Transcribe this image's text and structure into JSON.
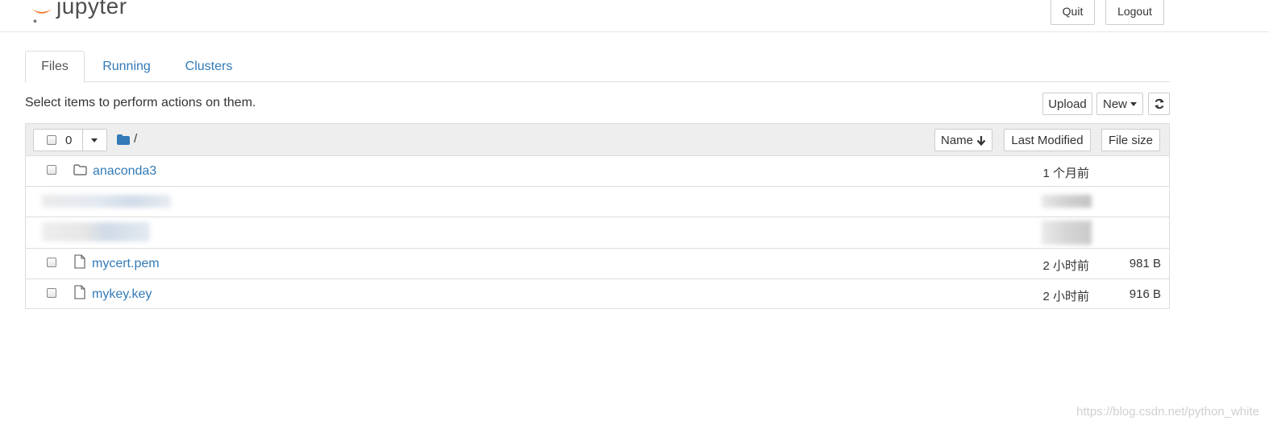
{
  "header": {
    "logo_text": "jupyter",
    "quit_label": "Quit",
    "logout_label": "Logout"
  },
  "tabs": [
    {
      "label": "Files",
      "active": true
    },
    {
      "label": "Running",
      "active": false
    },
    {
      "label": "Clusters",
      "active": false
    }
  ],
  "toolbar": {
    "message": "Select items to perform actions on them.",
    "upload_label": "Upload",
    "new_label": "New",
    "refresh_icon": "refresh-icon"
  },
  "list_header": {
    "selected_count": "0",
    "path": "/",
    "sort_name_label": "Name",
    "sort_modified_label": "Last Modified",
    "sort_size_label": "File size"
  },
  "items": [
    {
      "name": "anaconda3",
      "type": "folder",
      "modified": "1 个月前",
      "size": ""
    },
    {
      "name": "mycert.pem",
      "type": "file",
      "modified": "2 小时前",
      "size": "981 B"
    },
    {
      "name": "mykey.key",
      "type": "file",
      "modified": "2 小时前",
      "size": "916 B"
    }
  ],
  "watermark": "https://blog.csdn.net/python_white",
  "colors": {
    "link": "#337ab7",
    "logo_orange": "#f37726",
    "header_bg": "#eeeeee"
  }
}
